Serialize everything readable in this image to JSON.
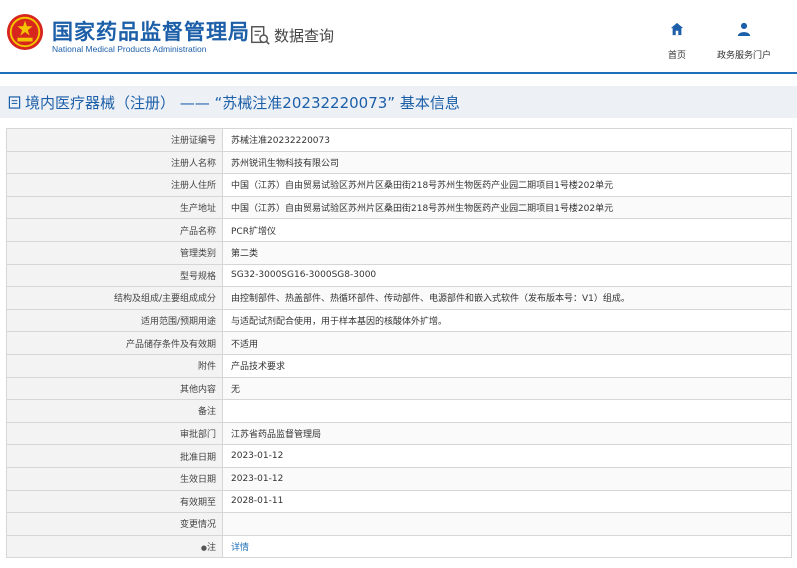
{
  "header": {
    "brand_cn": "国家药品监督管理局",
    "brand_en": "National Medical Products Administration",
    "query_label": "数据查询",
    "nav": [
      {
        "label": "首页",
        "icon": "home-icon"
      },
      {
        "label": "政务服务门户",
        "icon": "user-icon"
      }
    ]
  },
  "page": {
    "title": "境内医疗器械（注册） —— “苏械注准20232220073” 基本信息"
  },
  "rows": [
    {
      "label": "注册证编号",
      "value": "苏械注准20232220073"
    },
    {
      "label": "注册人名称",
      "value": "苏州锐讯生物科技有限公司"
    },
    {
      "label": "注册人住所",
      "value": "中国（江苏）自由贸易试验区苏州片区桑田街218号苏州生物医药产业园二期项目1号楼202单元"
    },
    {
      "label": "生产地址",
      "value": "中国（江苏）自由贸易试验区苏州片区桑田街218号苏州生物医药产业园二期项目1号楼202单元"
    },
    {
      "label": "产品名称",
      "value": "PCR扩增仪"
    },
    {
      "label": "管理类别",
      "value": "第二类"
    },
    {
      "label": "型号规格",
      "value": "SG32-3000SG16-3000SG8-3000"
    },
    {
      "label": "结构及组成/主要组成成分",
      "value": "由控制部件、热盖部件、热循环部件、传动部件、电源部件和嵌入式软件（发布版本号：V1）组成。"
    },
    {
      "label": "适用范围/预期用途",
      "value": "与适配试剂配合使用，用于样本基因的核酸体外扩增。"
    },
    {
      "label": "产品储存条件及有效期",
      "value": "不适用"
    },
    {
      "label": "附件",
      "value": "产品技术要求"
    },
    {
      "label": "其他内容",
      "value": "无"
    },
    {
      "label": "备注",
      "value": ""
    },
    {
      "label": "审批部门",
      "value": "江苏省药品监督管理局"
    },
    {
      "label": "批准日期",
      "value": "2023-01-12"
    },
    {
      "label": "生效日期",
      "value": "2023-01-12"
    },
    {
      "label": "有效期至",
      "value": "2028-01-11"
    },
    {
      "label": "变更情况",
      "value": ""
    }
  ],
  "note_row": {
    "label": "注",
    "link_text": "详情"
  },
  "colors": {
    "brand_blue": "#1c5fa8",
    "title_bar_bg": "#edf1f6",
    "emblem_red": "#d7261e"
  }
}
